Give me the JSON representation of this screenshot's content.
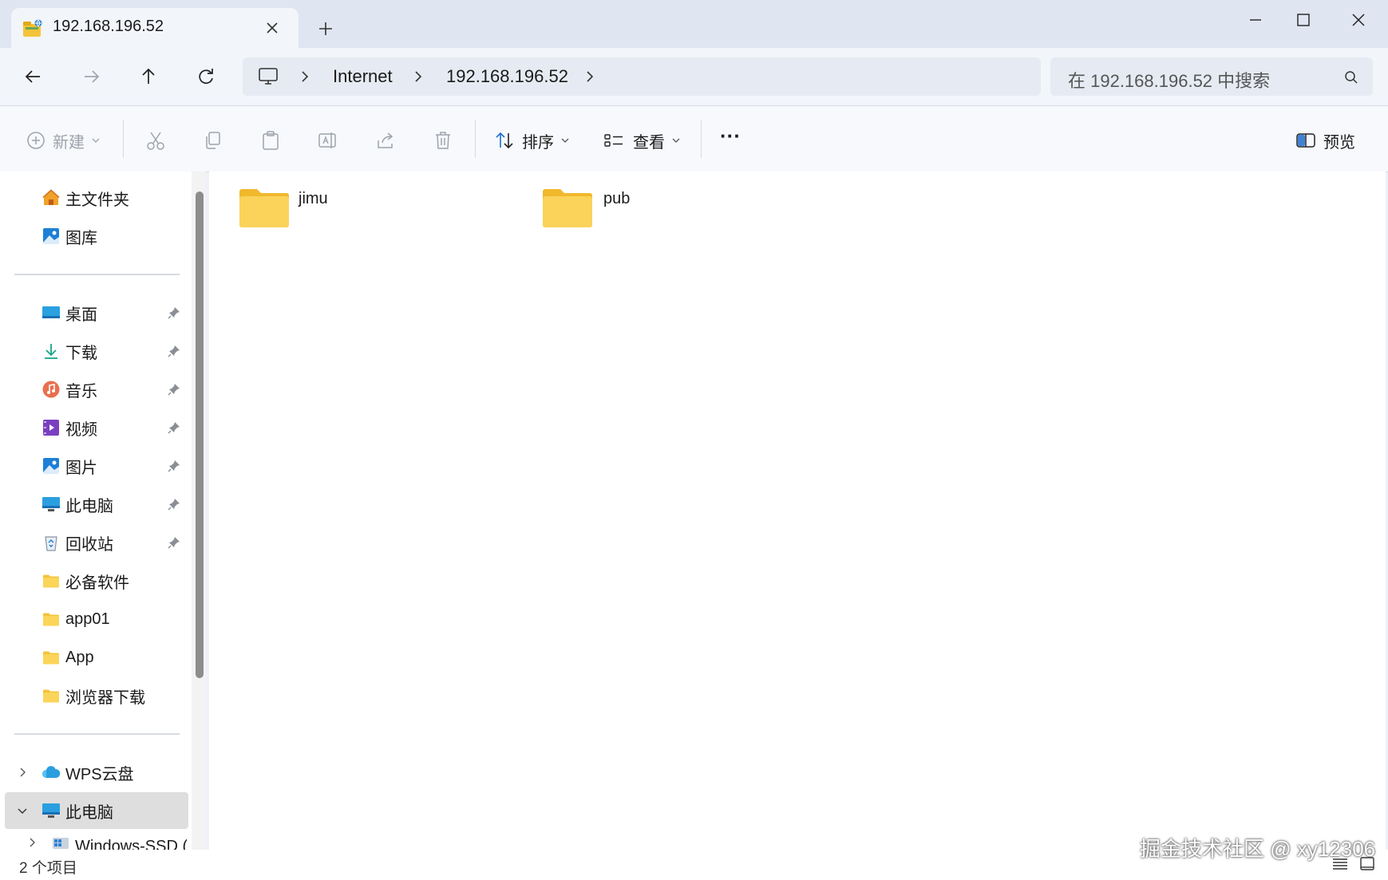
{
  "window": {
    "tab_title": "192.168.196.52",
    "new_tab_symbol": "+"
  },
  "address": {
    "crumbs": [
      "Internet",
      "192.168.196.52"
    ],
    "search_placeholder": "在 192.168.196.52 中搜索"
  },
  "toolbar": {
    "new_label": "新建",
    "sort_label": "排序",
    "view_label": "查看",
    "more_label": "···",
    "preview_label": "预览"
  },
  "sidebar": {
    "top_items": [
      {
        "label": "主文件夹",
        "icon": "home-icon"
      },
      {
        "label": "图库",
        "icon": "gallery-icon"
      }
    ],
    "pinned_items": [
      {
        "label": "桌面",
        "icon": "desktop-icon",
        "pinned": true
      },
      {
        "label": "下载",
        "icon": "download-icon",
        "pinned": true
      },
      {
        "label": "音乐",
        "icon": "music-icon",
        "pinned": true
      },
      {
        "label": "视频",
        "icon": "video-icon",
        "pinned": true
      },
      {
        "label": "图片",
        "icon": "pictures-icon",
        "pinned": true
      },
      {
        "label": "此电脑",
        "icon": "computer-icon",
        "pinned": true
      },
      {
        "label": "回收站",
        "icon": "recycle-bin-icon",
        "pinned": true
      },
      {
        "label": "必备软件",
        "icon": "folder-icon",
        "pinned": false
      },
      {
        "label": "app01",
        "icon": "folder-icon",
        "pinned": false
      },
      {
        "label": "App",
        "icon": "folder-icon",
        "pinned": false
      },
      {
        "label": "浏览器下载",
        "icon": "folder-icon",
        "pinned": false
      }
    ],
    "tree_items": [
      {
        "label": "WPS云盘",
        "icon": "cloud-icon",
        "expanded": false
      },
      {
        "label": "此电脑",
        "icon": "computer-icon",
        "expanded": true,
        "selected": true
      },
      {
        "label": "Windows-SSD (",
        "icon": "drive-icon",
        "expanded": false
      }
    ]
  },
  "content": {
    "folders": [
      {
        "name": "jimu"
      },
      {
        "name": "pub"
      }
    ]
  },
  "status": {
    "item_count": "2 个项目",
    "watermark": "掘金技术社区 @ xy12306"
  },
  "colors": {
    "folder_yellow": "#f8c93d",
    "accent_blue": "#1e6fd0",
    "selection_gray": "#dedede"
  }
}
